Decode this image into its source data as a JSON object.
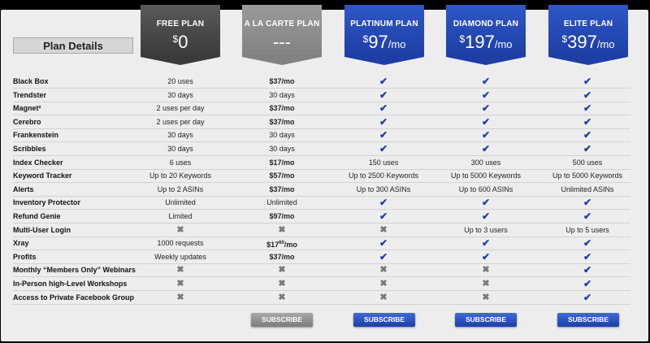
{
  "title": "Plan Details",
  "plans": [
    {
      "name": "FREE PLAN",
      "currency": "$",
      "amount": "0",
      "per": ""
    },
    {
      "name": "A LA CARTE PLAN",
      "currency": "",
      "amount": "---",
      "per": ""
    },
    {
      "name": "PLATINUM PLAN",
      "currency": "$",
      "amount": "97",
      "per": "/mo"
    },
    {
      "name": "DIAMOND PLAN",
      "currency": "$",
      "amount": "197",
      "per": "/mo"
    },
    {
      "name": "ELITE PLAN",
      "currency": "$",
      "amount": "397",
      "per": "/mo"
    }
  ],
  "features": [
    {
      "label": "Black Box",
      "values": [
        "20 uses",
        "$37/mo",
        "check",
        "check",
        "check"
      ]
    },
    {
      "label": "Trendster",
      "values": [
        "30 days",
        "30 days",
        "check",
        "check",
        "check"
      ]
    },
    {
      "label": "Magnet²",
      "values": [
        "2 uses per day",
        "$37/mo",
        "check",
        "check",
        "check"
      ]
    },
    {
      "label": "Cerebro",
      "values": [
        "2 uses per day",
        "$37/mo",
        "check",
        "check",
        "check"
      ]
    },
    {
      "label": "Frankenstein",
      "values": [
        "30 days",
        "30 days",
        "check",
        "check",
        "check"
      ]
    },
    {
      "label": "Scribbles",
      "values": [
        "30 days",
        "30 days",
        "check",
        "check",
        "check"
      ]
    },
    {
      "label": "Index Checker",
      "values": [
        "6 uses",
        "$17/mo",
        "150 uses",
        "300 uses",
        "500 uses"
      ]
    },
    {
      "label": "Keyword Tracker",
      "values": [
        "Up to 20 Keywords",
        "$57/mo",
        "Up to 2500 Keywords",
        "Up to 5000 Keywords",
        "Up to 5000 Keywords"
      ]
    },
    {
      "label": "Alerts",
      "values": [
        "Up to 2 ASINs",
        "$37/mo",
        "Up to 300 ASINs",
        "Up to 600 ASINs",
        "Unlimited ASINs"
      ]
    },
    {
      "label": "Inventory Protector",
      "values": [
        "Unlimited",
        "Unlimited",
        "check",
        "check",
        "check"
      ]
    },
    {
      "label": "Refund Genie",
      "values": [
        "Limited",
        "$97/mo",
        "check",
        "check",
        "check"
      ]
    },
    {
      "label": "Multi-User Login",
      "values": [
        "x",
        "x",
        "x",
        "Up to 3 users",
        "Up to 5 users"
      ]
    },
    {
      "label": "Xray",
      "values": [
        "1000 requests",
        "$17^60/mo",
        "check",
        "check",
        "check"
      ]
    },
    {
      "label": "Profits",
      "values": [
        "Weekly updates",
        "$37/mo",
        "check",
        "check",
        "check"
      ]
    },
    {
      "label": "Monthly “Members Only” Webinars",
      "values": [
        "x",
        "x",
        "x",
        "x",
        "check"
      ]
    },
    {
      "label": "In-Person high-Level Workshops",
      "values": [
        "x",
        "x",
        "x",
        "x",
        "check"
      ]
    },
    {
      "label": "Access to Private Facebook Group",
      "values": [
        "x",
        "x",
        "x",
        "x",
        "check"
      ]
    }
  ],
  "subscribe_label": "SUBSCRIBE",
  "colors": {
    "dark_header": "#3a3a3a",
    "gray_header": "#828282",
    "blue_header": "#1d3ea4",
    "check": "#1a3fa8",
    "panel": "#ededed"
  },
  "icons": {
    "check": "check-icon",
    "x": "x-icon"
  }
}
